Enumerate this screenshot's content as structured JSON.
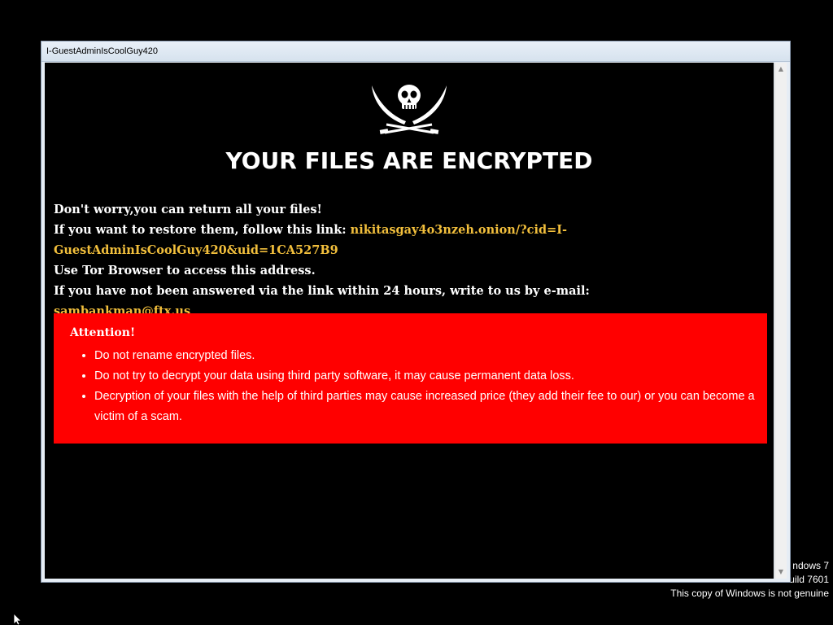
{
  "window": {
    "title": "I-GuestAdminIsCoolGuy420"
  },
  "ransom_note": {
    "logo_icon": "jolly-roger-skull-crossed-swords-icon",
    "heading": "YOUR FILES ARE ENCRYPTED",
    "line1": "Don't worry,you can return all your files!",
    "line2_prefix": "If you want to restore them, follow this link: ",
    "link_part1": "nikitasgay4o3nzeh.onion/?cid=I-",
    "link_part2": "GuestAdminIsCoolGuy420&uid=1CA527B9",
    "line3": "Use Tor Browser to access this address.",
    "line4_prefix": "If you have not been answered via the link within 24 hours, write to us by e-mail: ",
    "email": "sambankman@ftx.us",
    "highlight_color": "#f2bf3c"
  },
  "attention": {
    "title": "Attention!",
    "background_color": "#ff0000",
    "items": [
      "Do not rename encrypted files.",
      "Do not try to decrypt your data using third party software, it may cause permanent data loss.",
      "Decryption of your files with the help of third parties may cause increased price (they add their fee to our) or you can become a victim of a scam."
    ]
  },
  "desktop": {
    "watermark_line1": "ndows 7",
    "watermark_line2": "uild 7601",
    "watermark_line3": "This copy of Windows is not genuine"
  }
}
